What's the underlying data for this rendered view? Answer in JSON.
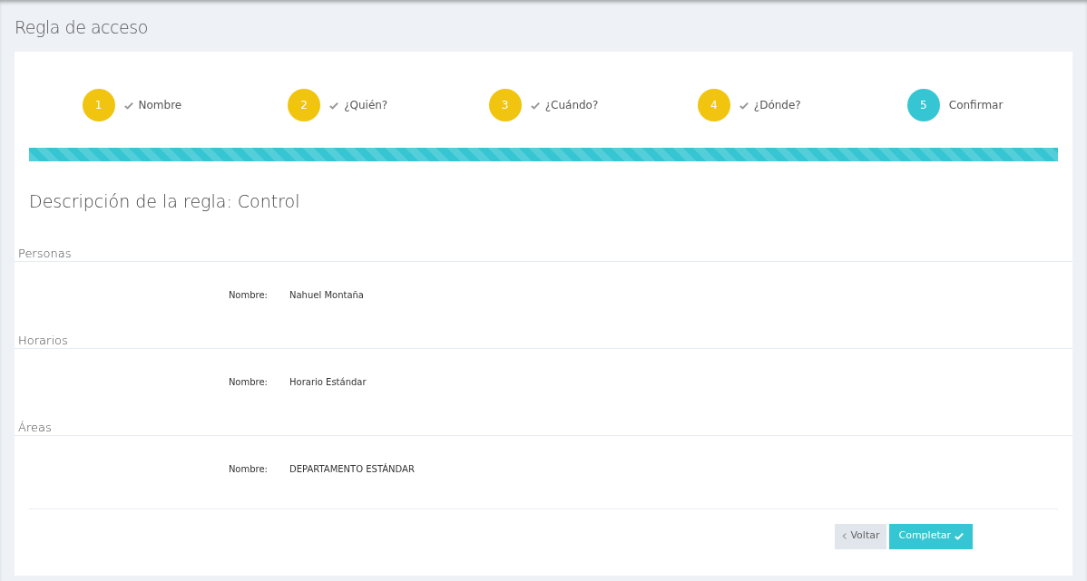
{
  "page_title": "Regla de acceso",
  "steps": [
    {
      "number": "1",
      "label": "Nombre",
      "done": true
    },
    {
      "number": "2",
      "label": "¿Quién?",
      "done": true
    },
    {
      "number": "3",
      "label": "¿Cuándo?",
      "done": true
    },
    {
      "number": "4",
      "label": "¿Dónde?",
      "done": true
    },
    {
      "number": "5",
      "label": "Confirmar",
      "done": false
    }
  ],
  "progress": {
    "level": 1
  },
  "heading": "Descripción de la regla: Control",
  "sections": [
    {
      "title": "Personas",
      "fields": [
        {
          "label": "Nombre:",
          "value": "Nahuel Montaña"
        }
      ]
    },
    {
      "title": "Horarios",
      "fields": [
        {
          "label": "Nombre:",
          "value": "Horario Estándar"
        }
      ]
    },
    {
      "title": "Áreas",
      "fields": [
        {
          "label": "Nombre:",
          "value": "DEPARTAMENTO ESTÁNDAR"
        }
      ]
    }
  ],
  "buttons": {
    "back": "Voltar",
    "complete": "Completar"
  }
}
